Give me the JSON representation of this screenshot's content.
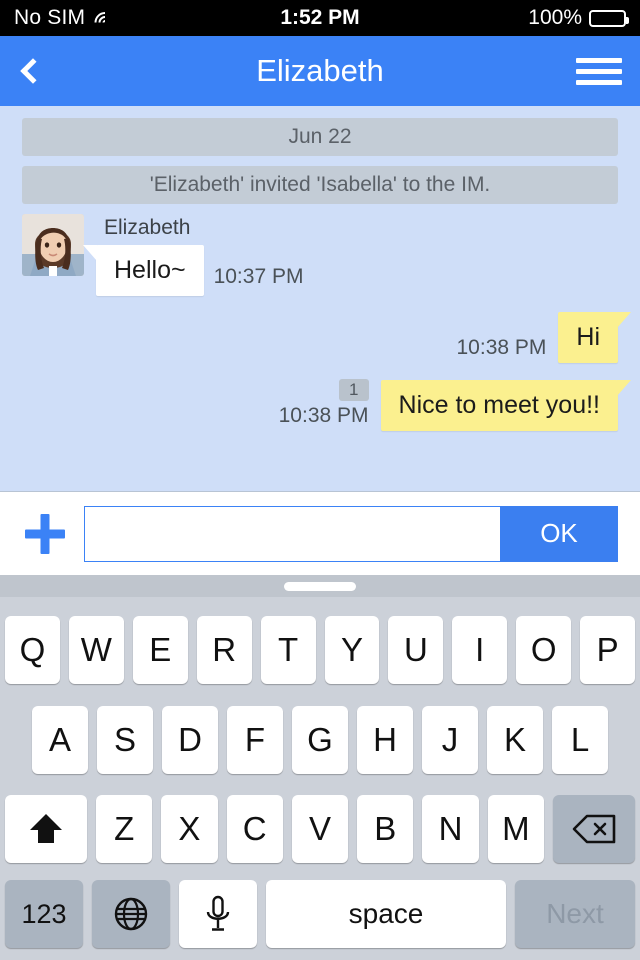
{
  "statusbar": {
    "carrier": "No SIM",
    "wifi_icon": "wifi-icon",
    "time": "1:52 PM",
    "battery_percent": "100%",
    "battery_icon": "battery-full-icon"
  },
  "navbar": {
    "back_icon": "back-chevron-icon",
    "title": "Elizabeth",
    "menu_icon": "hamburger-menu-icon"
  },
  "chat": {
    "background_color": "#cfdef8",
    "date_divider": "Jun 22",
    "system_message": "'Elizabeth' invited 'Isabella' to the IM.",
    "incoming": [
      {
        "sender": "Elizabeth",
        "avatar": "user-avatar",
        "text": "Hello~",
        "time": "10:37 PM",
        "bubble_color": "#ffffff"
      }
    ],
    "outgoing": [
      {
        "text": "Hi",
        "time": "10:38 PM",
        "unread": "",
        "bubble_color": "#fbf08f"
      },
      {
        "text": "Nice to meet you!!",
        "time": "10:38 PM",
        "unread": "1",
        "bubble_color": "#fbf08f"
      }
    ]
  },
  "inputbar": {
    "plus_icon": "plus-icon",
    "input_value": "",
    "input_placeholder": "",
    "send_label": "OK",
    "accent_color": "#3b7ff0"
  },
  "keyboard": {
    "handle_icon": "drag-handle",
    "row1": [
      "Q",
      "W",
      "E",
      "R",
      "T",
      "Y",
      "U",
      "I",
      "O",
      "P"
    ],
    "row2": [
      "A",
      "S",
      "D",
      "F",
      "G",
      "H",
      "J",
      "K",
      "L"
    ],
    "row3": [
      "Z",
      "X",
      "C",
      "V",
      "B",
      "N",
      "M"
    ],
    "shift_icon": "shift-arrow-icon",
    "delete_icon": "backspace-icon",
    "numeric_label": "123",
    "globe_icon": "globe-icon",
    "mic_icon": "microphone-icon",
    "space_label": "space",
    "next_label": "Next"
  }
}
